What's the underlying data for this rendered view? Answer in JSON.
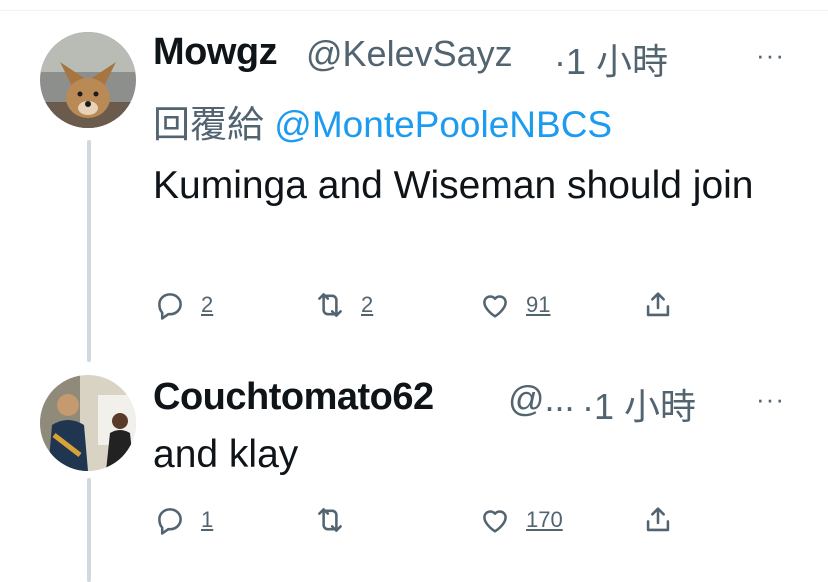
{
  "tweets": [
    {
      "name": "Mowgz",
      "handle": "@KelevSayz",
      "time": "·1 小時",
      "more": "···",
      "reply_prefix": "回覆給",
      "reply_to": "@MontePooleNBCS",
      "text": "Kuminga and Wiseman should join",
      "actions": {
        "reply": "2",
        "retweet": "2",
        "like": "91"
      }
    },
    {
      "name": "Couchtomato62",
      "handle": "@...",
      "time": "·1 小時",
      "more": "···",
      "text": "and klay",
      "actions": {
        "reply": "1",
        "like": "170"
      }
    }
  ],
  "colors": {
    "accent": "#1d9bf0",
    "secondary_text": "#536471",
    "thread_line": "#cfd9de"
  },
  "icons": [
    "reply-icon",
    "retweet-icon",
    "like-icon",
    "share-icon",
    "more-icon"
  ]
}
